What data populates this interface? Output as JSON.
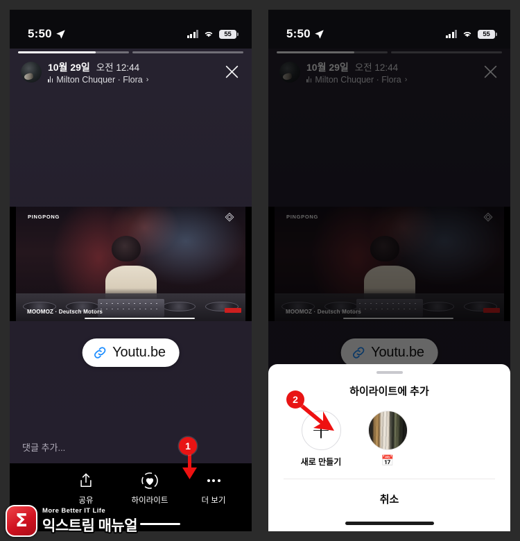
{
  "status_bar": {
    "time": "5:50",
    "battery": "55",
    "location_icon": "location-arrow-icon",
    "signal_icon": "cellular-bars-icon",
    "wifi_icon": "wifi-icon"
  },
  "story": {
    "progress": {
      "segments": 2,
      "active_index": 0,
      "active_fill_percent": 70
    },
    "header": {
      "date": "10월 29일",
      "time": "오전 12:44",
      "music_icon": "music-waveform-icon",
      "music": "Milton Chuquer · Flora",
      "chevron": "›",
      "close_icon": "close-x-icon"
    },
    "media": {
      "brand_top_left": "PINGPONG",
      "brand_bottom_left": "MOOMOZ · Deutsch Motors",
      "logo_icon": "diamond-logo-icon"
    },
    "link_chip": {
      "icon": "link-chain-icon",
      "label": "Youtu.be"
    },
    "comment_placeholder": "댓글 추가..."
  },
  "actionbar": {
    "items": [
      {
        "icon": "share-upload-icon",
        "label": "공유"
      },
      {
        "icon": "highlight-heart-icon",
        "label": "하이라이트"
      },
      {
        "icon": "more-dots-icon",
        "label": "더 보기"
      }
    ]
  },
  "sheet": {
    "title": "하이라이트에 추가",
    "new_item": {
      "icon": "plus-icon",
      "label": "새로 만들기"
    },
    "highlights": [
      {
        "label": "📅",
        "icon": "highlight-thumbnail"
      }
    ],
    "cancel_label": "취소"
  },
  "annotations": [
    {
      "id": "1",
      "target": "highlight-button"
    },
    {
      "id": "2",
      "target": "highlight-thumbnail"
    }
  ],
  "watermark": {
    "logo_glyph": "Σ",
    "tagline": "More Better IT Life",
    "name": "익스트림 매뉴얼"
  },
  "colors": {
    "accent_red": "#e81414",
    "sheet_bg": "#ffffff",
    "story_bg": "#26222f",
    "chip_link_blue": "#1a8cff"
  }
}
